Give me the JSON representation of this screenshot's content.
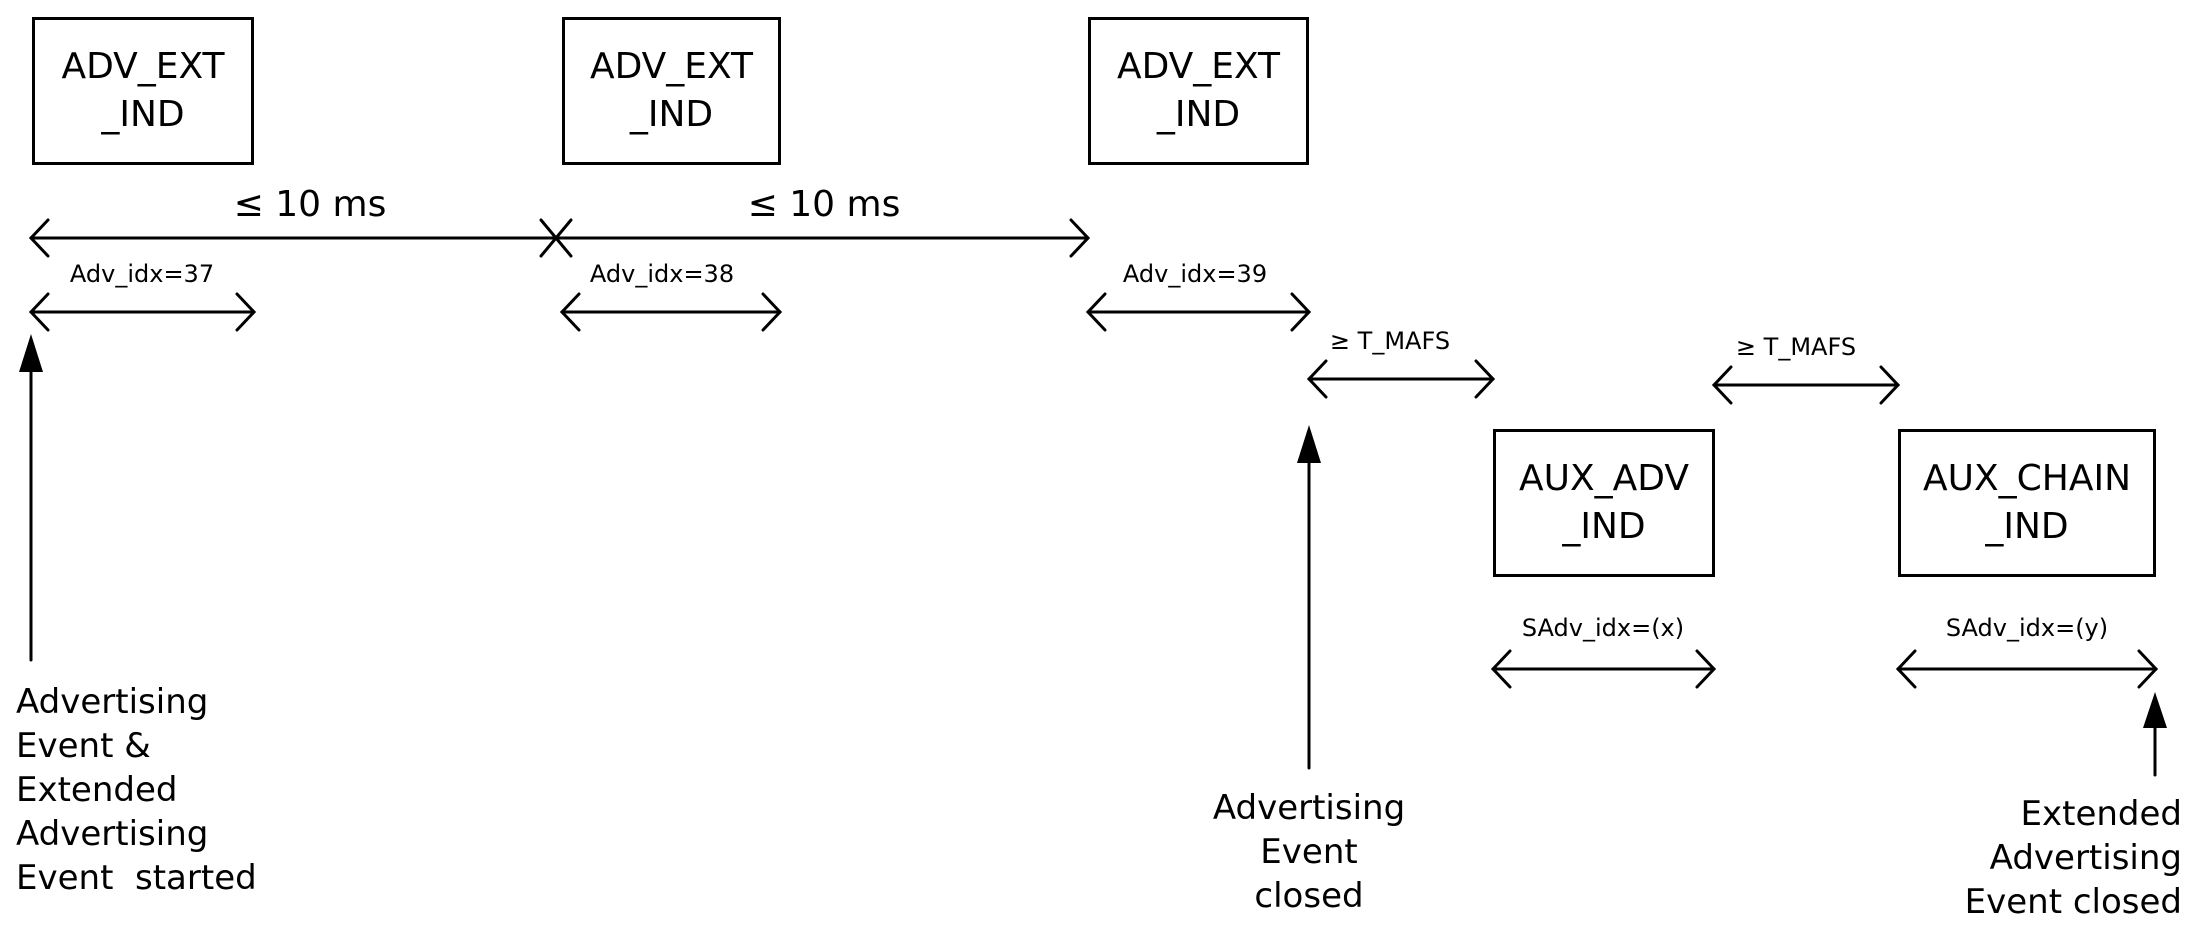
{
  "diagram": {
    "packets": [
      {
        "line1": "ADV_EXT",
        "line2": "_IND"
      },
      {
        "line1": "ADV_EXT",
        "line2": "_IND"
      },
      {
        "line1": "ADV_EXT",
        "line2": "_IND"
      },
      {
        "line1": "AUX_ADV",
        "line2": "_IND"
      },
      {
        "line1": "AUX_CHAIN",
        "line2": "_IND"
      }
    ],
    "intervals": [
      {
        "label": "≤ 10 ms"
      },
      {
        "label": "≤ 10 ms"
      }
    ],
    "indices": [
      {
        "label": "Adv_idx=37"
      },
      {
        "label": "Adv_idx=38"
      },
      {
        "label": "Adv_idx=39"
      },
      {
        "label": "SAdv_idx=(x)"
      },
      {
        "label": "SAdv_idx=(y)"
      }
    ],
    "gaps": [
      {
        "label": "≥ T_MAFS"
      },
      {
        "label": "≥ T_MAFS"
      }
    ],
    "events": [
      {
        "lines": [
          "Advertising",
          "Event &",
          "Extended",
          "Advertising",
          "Event  started"
        ]
      },
      {
        "lines": [
          "Advertising",
          "Event",
          "closed"
        ]
      },
      {
        "lines": [
          "Extended",
          "Advertising",
          "Event closed"
        ]
      }
    ]
  }
}
